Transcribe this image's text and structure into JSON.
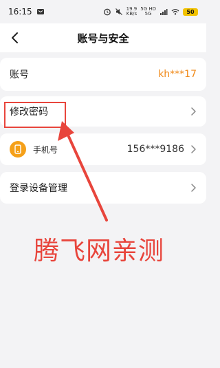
{
  "status_bar": {
    "time": "16:15",
    "speed_value": "19.9",
    "speed_unit": "KB/s",
    "network_top": "5G HD",
    "network_bottom": "5G",
    "battery": "50"
  },
  "nav": {
    "title": "账号与安全"
  },
  "account_row": {
    "label": "账号",
    "value": "kh***17"
  },
  "password_row": {
    "label": "修改密码"
  },
  "phone_row": {
    "label": "手机号",
    "value": "156***9186"
  },
  "device_row": {
    "label": "登录设备管理"
  },
  "annotation": {
    "watermark": "腾飞网亲测"
  },
  "colors": {
    "accent_orange": "#f08a1a",
    "phone_icon_bg": "#f5a019",
    "annotation_red": "#e8453c",
    "page_bg": "#f3f3f5"
  }
}
